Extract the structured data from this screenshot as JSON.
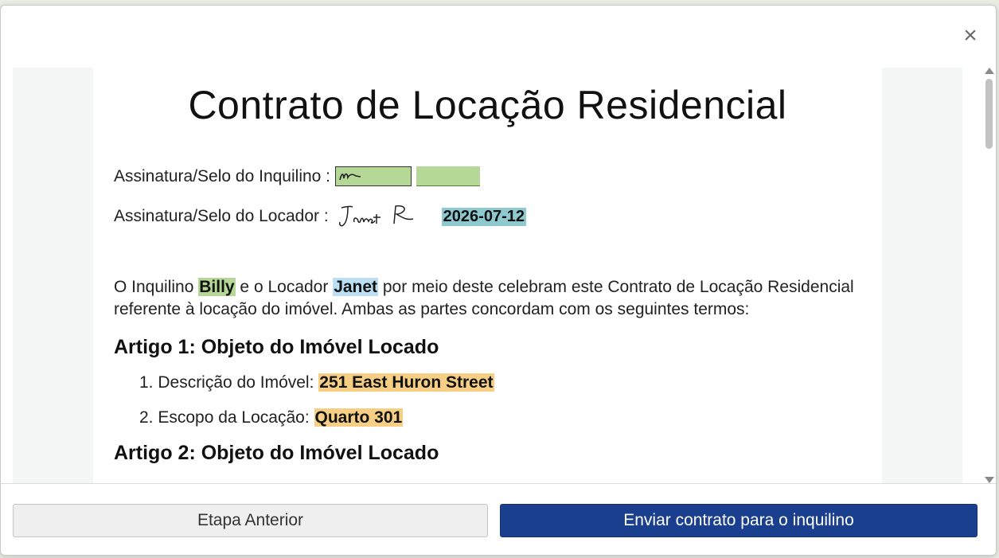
{
  "dialog": {
    "close_glyph": "×"
  },
  "document": {
    "title": "Contrato de Locação Residencial",
    "tenant_signature_label": "Assinatura/Selo do Inquilino :",
    "landlord_signature_label": "Assinatura/Selo do Locador :",
    "signature_date": "2026-07-12",
    "paragraph": {
      "part1": "O Inquilino ",
      "tenant_name": "Billy",
      "part2": " e o Locador ",
      "landlord_name": "Janet",
      "part3": " por meio deste celebram este Contrato de Locação Residencial referente à locação do imóvel. Ambas as partes concordam com os seguintes termos:"
    },
    "article1_title": "Artigo 1: Objeto do Imóvel Locado",
    "items": [
      {
        "label": "1. Descrição do Imóvel: ",
        "value": "251 East Huron Street"
      },
      {
        "label": "2. Escopo da Locação: ",
        "value": "Quarto 301"
      }
    ],
    "article2_title": "Artigo 2: Objeto do Imóvel Locado"
  },
  "footer": {
    "prev_label": "Etapa Anterior",
    "send_label": "Enviar contrato para o inquilino"
  },
  "colors": {
    "tenant_highlight": "#b6d896",
    "landlord_highlight": "#bcdff3",
    "property_highlight": "#f6cf85",
    "date_highlight": "#8fc9d0",
    "primary_button": "#1b3f8f"
  },
  "icons": {
    "close": "close-icon",
    "scroll_up": "arrow-up-icon",
    "scroll_down": "arrow-down-icon"
  }
}
